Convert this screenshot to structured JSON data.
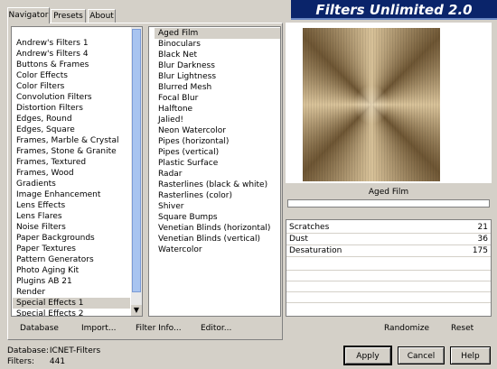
{
  "tabs": [
    {
      "label": "Navigator",
      "active": true
    },
    {
      "label": "Presets",
      "active": false
    },
    {
      "label": "About",
      "active": false
    }
  ],
  "app_title": "Filters Unlimited 2.0",
  "categories": [
    "Andrew's Filters 1",
    "Andrew's Filters 4",
    "Buttons & Frames",
    "Color Effects",
    "Color Filters",
    "Convolution Filters",
    "Distortion Filters",
    "Edges, Round",
    "Edges, Square",
    "Frames, Marble & Crystal",
    "Frames, Stone & Granite",
    "Frames, Textured",
    "Frames, Wood",
    "Gradients",
    "Image Enhancement",
    "Lens Effects",
    "Lens Flares",
    "Noise Filters",
    "Paper Backgrounds",
    "Paper Textures",
    "Pattern Generators",
    "Photo Aging Kit",
    "Plugins AB 21",
    "Render",
    "Special Effects 1",
    "Special Effects 2"
  ],
  "selected_category": "Special Effects 1",
  "filters": [
    "Aged Film",
    "Binoculars",
    "Black Net",
    "Blur Darkness",
    "Blur Lightness",
    "Blurred Mesh",
    "Focal Blur",
    "Halftone",
    "Jalied!",
    "Neon Watercolor",
    "Pipes (horizontal)",
    "Pipes (vertical)",
    "Plastic Surface",
    "Radar",
    "Rasterlines (black & white)",
    "Rasterlines (color)",
    "Shiver",
    "Square Bumps",
    "Venetian Blinds (horizontal)",
    "Venetian Blinds (vertical)",
    "Watercolor"
  ],
  "selected_filter": "Aged Film",
  "left_buttons": {
    "database": "Database",
    "import": "Import...",
    "filter_info": "Filter Info...",
    "editor": "Editor..."
  },
  "preview": {
    "filter_name": "Aged Film"
  },
  "params": [
    {
      "label": "Scratches",
      "value": "21"
    },
    {
      "label": "Dust",
      "value": "36"
    },
    {
      "label": "Desaturation",
      "value": "175"
    }
  ],
  "right_buttons": {
    "randomize": "Randomize",
    "reset": "Reset"
  },
  "status": {
    "database_label": "Database:",
    "database_value": "ICNET-Filters",
    "filters_label": "Filters:",
    "filters_value": "441"
  },
  "dialog_buttons": {
    "apply": "Apply",
    "cancel": "Cancel",
    "help": "Help"
  },
  "colors": {
    "title_bg": "#0a246a",
    "window_bg": "#d4d0c8",
    "scroll_thumb": "#a8c4f0"
  }
}
